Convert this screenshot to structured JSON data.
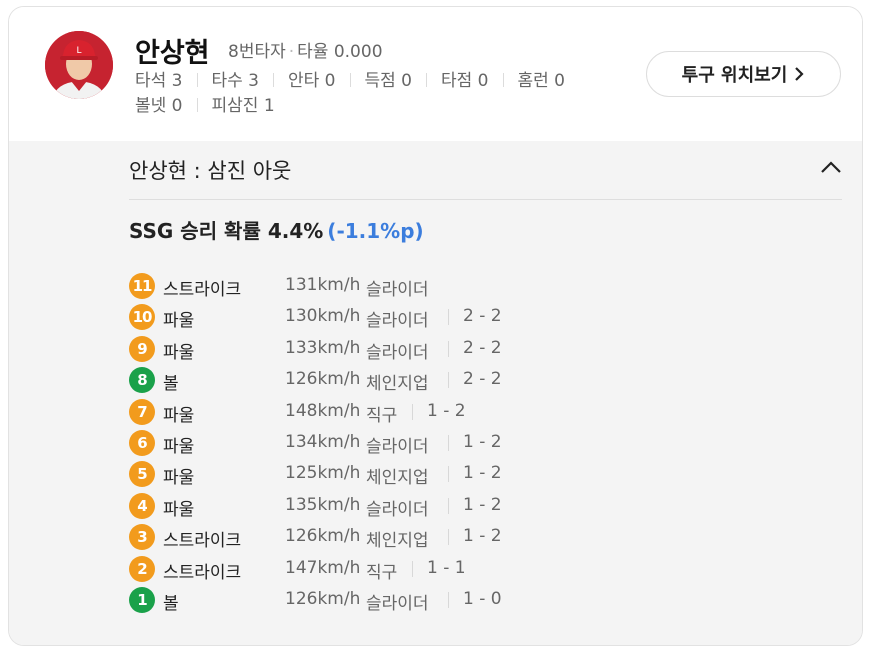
{
  "player": {
    "name": "안상현",
    "order": "8번타자",
    "avg_label": "타율 0.000",
    "stats": [
      "타석 3",
      "타수 3",
      "안타 0",
      "득점 0",
      "타점 0",
      "홈런 0",
      "볼넷 0",
      "피삼진 1"
    ]
  },
  "pitch_button": {
    "label": "투구 위치보기"
  },
  "result": {
    "text": "안상현 : 삼진 아웃"
  },
  "win_prob": {
    "label": "SSG 승리 확률 4.4%",
    "change": "(-1.1%p)"
  },
  "colors": {
    "orange": "#f29b1d",
    "green": "#1aa14a",
    "blue": "#3b7ddd"
  },
  "pitches": [
    {
      "num": "11",
      "result": "스트라이크",
      "speed": "131km/h",
      "type": "슬라이더",
      "count": "",
      "color": "orange"
    },
    {
      "num": "10",
      "result": "파울",
      "speed": "130km/h",
      "type": "슬라이더",
      "count": "2 - 2",
      "color": "orange"
    },
    {
      "num": "9",
      "result": "파울",
      "speed": "133km/h",
      "type": "슬라이더",
      "count": "2 - 2",
      "color": "orange"
    },
    {
      "num": "8",
      "result": "볼",
      "speed": "126km/h",
      "type": "체인지업",
      "count": "2 - 2",
      "color": "green"
    },
    {
      "num": "7",
      "result": "파울",
      "speed": "148km/h",
      "type": "직구",
      "count": "1 - 2",
      "color": "orange"
    },
    {
      "num": "6",
      "result": "파울",
      "speed": "134km/h",
      "type": "슬라이더",
      "count": "1 - 2",
      "color": "orange"
    },
    {
      "num": "5",
      "result": "파울",
      "speed": "125km/h",
      "type": "체인지업",
      "count": "1 - 2",
      "color": "orange"
    },
    {
      "num": "4",
      "result": "파울",
      "speed": "135km/h",
      "type": "슬라이더",
      "count": "1 - 2",
      "color": "orange"
    },
    {
      "num": "3",
      "result": "스트라이크",
      "speed": "126km/h",
      "type": "체인지업",
      "count": "1 - 2",
      "color": "orange"
    },
    {
      "num": "2",
      "result": "스트라이크",
      "speed": "147km/h",
      "type": "직구",
      "count": "1 - 1",
      "color": "orange"
    },
    {
      "num": "1",
      "result": "볼",
      "speed": "126km/h",
      "type": "슬라이더",
      "count": "1 - 0",
      "color": "green"
    }
  ]
}
